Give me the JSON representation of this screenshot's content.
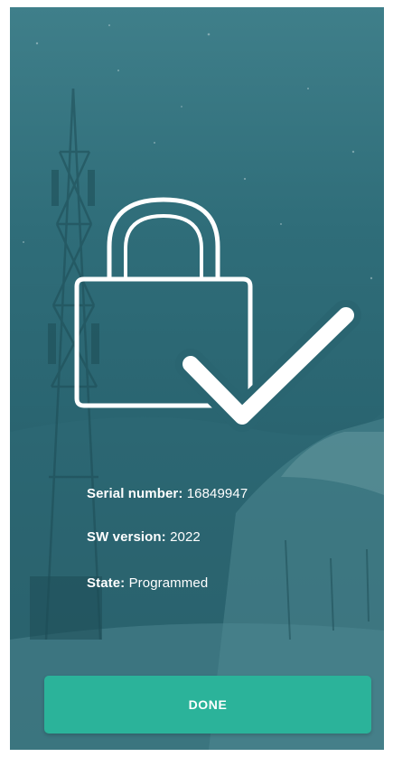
{
  "icons": {
    "status": "lock-check-icon"
  },
  "colors": {
    "background": "#2a6571",
    "accent": "#2bb39a",
    "text": "#ffffff"
  },
  "device_info": {
    "serial_label": "Serial number:",
    "serial_value": "16849947",
    "sw_label": "SW version:",
    "sw_value": "2022",
    "state_label": "State:",
    "state_value": "Programmed"
  },
  "actions": {
    "done_label": "DONE"
  }
}
